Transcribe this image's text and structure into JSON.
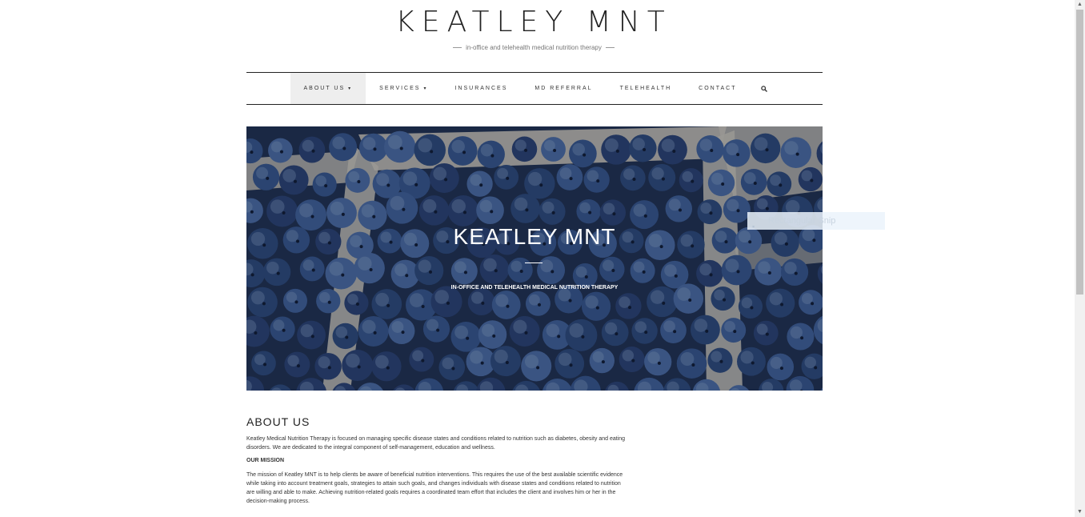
{
  "site": {
    "title": "KEATLEY MNT",
    "tagline": "in-office and telehealth medical nutrition therapy"
  },
  "nav": {
    "items": [
      {
        "label": "ABOUT US",
        "caret": "▾",
        "active": true
      },
      {
        "label": "SERVICES",
        "caret": "▾",
        "active": false
      },
      {
        "label": "INSURANCES",
        "caret": "",
        "active": false
      },
      {
        "label": "MD REFERRAL",
        "caret": "",
        "active": false
      },
      {
        "label": "TELEHEALTH",
        "caret": "",
        "active": false
      },
      {
        "label": "CONTACT",
        "caret": "",
        "active": false
      }
    ],
    "search_icon": "search-icon"
  },
  "hero": {
    "title": "KEATLEY MNT",
    "subtitle": "IN-OFFICE AND TELEHEALTH MEDICAL NUTRITION THERAPY",
    "image": "blueberries-in-cartons"
  },
  "overlay": {
    "snip_label": "Rectangular Snip"
  },
  "about": {
    "heading": "ABOUT US",
    "intro": "Keatley Medical Nutrition Therapy is focused on managing specific disease states and conditions related to nutrition such as diabetes, obesity and eating disorders. We are dedicated to the integral component of self-management, education and wellness.",
    "mission_heading": "OUR MISSION",
    "mission_text": "The mission of Keatley MNT is to help clients be aware of beneficial nutrition interventions. This requires the use of the best available scientific evidence while taking into account treatment goals, strategies to attain such goals, and changes individuals with disease states and conditions related to nutrition are willing and able to make. Achieving nutrition-related goals requires a coordinated team effort that includes the client and involves him or her in the decision-making process."
  },
  "colors": {
    "text": "#222222",
    "nav_active_bg": "#eeeeee",
    "hero_bg": "#1e2e4d",
    "berry": "#3a5a8c",
    "carton": "#c9c4b8"
  }
}
